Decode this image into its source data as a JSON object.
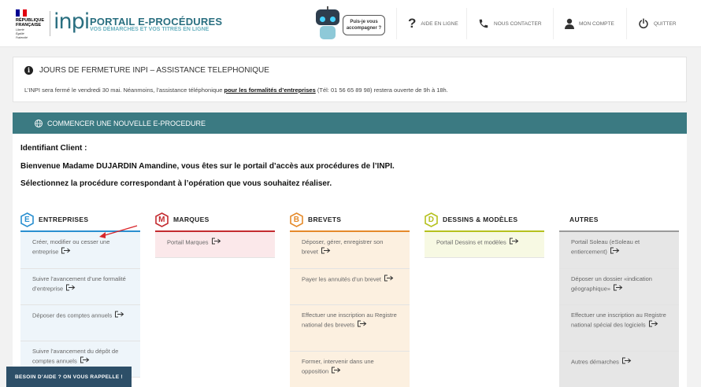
{
  "header": {
    "republic": [
      "RÉPUBLIQUE",
      "FRANÇAISE"
    ],
    "motto": [
      "Liberté",
      "Égalité",
      "Fraternité"
    ],
    "logo": "inpi",
    "portal_title": "PORTAIL E-PROCÉDURES",
    "portal_subtitle": "VOS DÉMARCHES ET VOS TITRES EN LIGNE",
    "bubble": [
      "Puis-je vous",
      "accompagner ?"
    ],
    "nav": {
      "help": "AIDE EN LIGNE",
      "contact": "NOUS CONTACTER",
      "account": "MON COMPTE",
      "quit": "QUITTER"
    }
  },
  "alert": {
    "title": "JOURS DE FERMETURE INPI – ASSISTANCE TELEPHONIQUE",
    "text_before": "L’INPI sera fermé le vendredi 30 mai. Néanmoins, l’assistance téléphonique ",
    "link": "pour les formalités d’entreprises",
    "text_after": " (Tél: 01 56 65 89 98) restera ouverte de 9h à 18h."
  },
  "section": {
    "banner": "COMMENCER UNE NOUVELLE E-PROCEDURE",
    "client_label": "Identifiant Client :",
    "welcome": "Bienvenue Madame DUJARDIN Amandine, vous êtes sur le portail d’accès aux procédures de l’INPI.",
    "select": "Sélectionnez la procédure correspondant à l’opération que vous souhaitez réaliser."
  },
  "columns": [
    {
      "letter": "E",
      "title": "ENTREPRISES",
      "color": "#2a8fd0",
      "bg": "#eef5fa",
      "items": [
        "Créer, modifier ou cesser une entreprise",
        "Suivre l’avancement d’une formalité d’entreprise",
        "Déposer des comptes annuels",
        "Suivre l’avancement du dépôt de comptes annuels"
      ]
    },
    {
      "letter": "M",
      "title": "MARQUES",
      "color": "#c42b30",
      "bg": "#fbe8ea",
      "items": [
        "Portail Marques"
      ]
    },
    {
      "letter": "B",
      "title": "BREVETS",
      "color": "#e58a2a",
      "bg": "#fcf0e0",
      "items": [
        "Déposer, gérer, enregistrer son brevet",
        "Payer les annuités d’un brevet",
        "Effectuer une inscription au Registre national des brevets",
        "Former, intervenir dans une opposition"
      ]
    },
    {
      "letter": "D",
      "title": "DESSINS & MODÈLES",
      "color": "#b5c11e",
      "bg": "#f7f9e3",
      "items": [
        "Portail Dessins et modèles"
      ]
    },
    {
      "letter": "",
      "title": "AUTRES",
      "color": "#9a9a9a",
      "bg": "#e6e6e6",
      "items": [
        "Portail Soleau (eSoleau et entiercement)",
        "Déposer un dossier «indication géographique»",
        "Effectuer une inscription au Registre national spécial des logiciels",
        "Autres démarches"
      ]
    }
  ],
  "help_button": "BESOIN D’AIDE ? ON VOUS RAPPELLE !"
}
